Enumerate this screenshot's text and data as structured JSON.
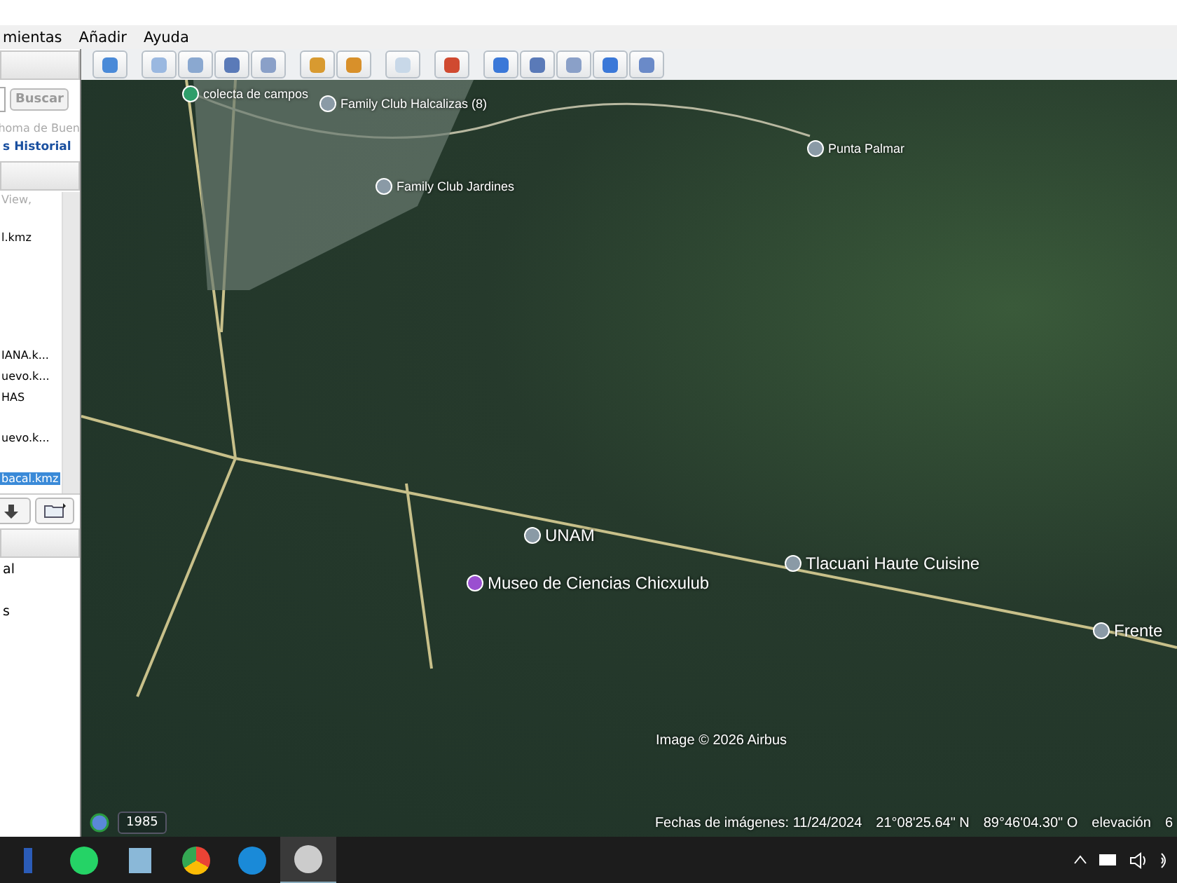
{
  "menu_bar": {
    "items": [
      "mientas",
      "Añadir",
      "Ayuda"
    ]
  },
  "sidebar": {
    "search": {
      "button": "Buscar",
      "hint": "homa de Buen"
    },
    "tabs": [
      {
        "label": "s",
        "selected": false
      },
      {
        "label": "Historial",
        "selected": false
      }
    ],
    "places": [
      {
        "label": "View,",
        "selected": false,
        "dim": true
      },
      {
        "label": "l.kmz",
        "selected": false,
        "dim": false
      },
      {
        "label": "IANA.k...",
        "selected": false,
        "dim": false
      },
      {
        "label": "uevo.k...",
        "selected": false,
        "dim": false
      },
      {
        "label": "HAS",
        "selected": false,
        "dim": false
      },
      {
        "label": "uevo.k...",
        "selected": false,
        "dim": false
      },
      {
        "label": "bacal.kmz",
        "selected": true,
        "dim": false
      }
    ],
    "layers": [
      "al",
      "s"
    ]
  },
  "map": {
    "pins": [
      {
        "label": "colecta de campos",
        "kind": "green"
      },
      {
        "label": "Family Club Halcalizas (8)",
        "kind": "grey"
      },
      {
        "label": "Family Club Jardines",
        "kind": "grey"
      },
      {
        "label": "Punta Palmar",
        "kind": "grey"
      },
      {
        "label": "UNAM",
        "kind": "grey"
      },
      {
        "label": "Museo de Ciencias Chicxulub",
        "kind": "purple"
      },
      {
        "label": "Tlacuani Haute Cuisine",
        "kind": "grey"
      },
      {
        "label": "Frente",
        "kind": "grey"
      }
    ],
    "attribution": "Image © 2026 Airbus",
    "year": "1985",
    "status": [
      "Fechas de imágenes: 11/24/2024",
      "21°08'25.64\" N",
      "89°46'04.30\" O",
      "elevación",
      "6"
    ]
  }
}
